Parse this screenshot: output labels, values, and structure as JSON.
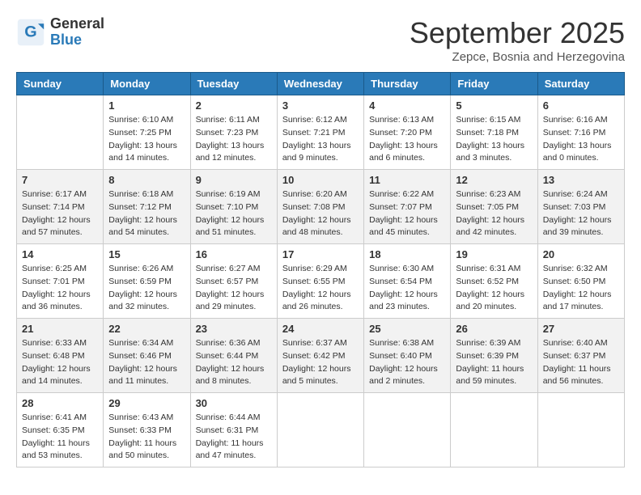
{
  "header": {
    "logo_general": "General",
    "logo_blue": "Blue",
    "month_title": "September 2025",
    "subtitle": "Zepce, Bosnia and Herzegovina"
  },
  "weekdays": [
    "Sunday",
    "Monday",
    "Tuesday",
    "Wednesday",
    "Thursday",
    "Friday",
    "Saturday"
  ],
  "weeks": [
    [
      {
        "day": "",
        "sunrise": "",
        "sunset": "",
        "daylight": ""
      },
      {
        "day": "1",
        "sunrise": "Sunrise: 6:10 AM",
        "sunset": "Sunset: 7:25 PM",
        "daylight": "Daylight: 13 hours and 14 minutes."
      },
      {
        "day": "2",
        "sunrise": "Sunrise: 6:11 AM",
        "sunset": "Sunset: 7:23 PM",
        "daylight": "Daylight: 13 hours and 12 minutes."
      },
      {
        "day": "3",
        "sunrise": "Sunrise: 6:12 AM",
        "sunset": "Sunset: 7:21 PM",
        "daylight": "Daylight: 13 hours and 9 minutes."
      },
      {
        "day": "4",
        "sunrise": "Sunrise: 6:13 AM",
        "sunset": "Sunset: 7:20 PM",
        "daylight": "Daylight: 13 hours and 6 minutes."
      },
      {
        "day": "5",
        "sunrise": "Sunrise: 6:15 AM",
        "sunset": "Sunset: 7:18 PM",
        "daylight": "Daylight: 13 hours and 3 minutes."
      },
      {
        "day": "6",
        "sunrise": "Sunrise: 6:16 AM",
        "sunset": "Sunset: 7:16 PM",
        "daylight": "Daylight: 13 hours and 0 minutes."
      }
    ],
    [
      {
        "day": "7",
        "sunrise": "Sunrise: 6:17 AM",
        "sunset": "Sunset: 7:14 PM",
        "daylight": "Daylight: 12 hours and 57 minutes."
      },
      {
        "day": "8",
        "sunrise": "Sunrise: 6:18 AM",
        "sunset": "Sunset: 7:12 PM",
        "daylight": "Daylight: 12 hours and 54 minutes."
      },
      {
        "day": "9",
        "sunrise": "Sunrise: 6:19 AM",
        "sunset": "Sunset: 7:10 PM",
        "daylight": "Daylight: 12 hours and 51 minutes."
      },
      {
        "day": "10",
        "sunrise": "Sunrise: 6:20 AM",
        "sunset": "Sunset: 7:08 PM",
        "daylight": "Daylight: 12 hours and 48 minutes."
      },
      {
        "day": "11",
        "sunrise": "Sunrise: 6:22 AM",
        "sunset": "Sunset: 7:07 PM",
        "daylight": "Daylight: 12 hours and 45 minutes."
      },
      {
        "day": "12",
        "sunrise": "Sunrise: 6:23 AM",
        "sunset": "Sunset: 7:05 PM",
        "daylight": "Daylight: 12 hours and 42 minutes."
      },
      {
        "day": "13",
        "sunrise": "Sunrise: 6:24 AM",
        "sunset": "Sunset: 7:03 PM",
        "daylight": "Daylight: 12 hours and 39 minutes."
      }
    ],
    [
      {
        "day": "14",
        "sunrise": "Sunrise: 6:25 AM",
        "sunset": "Sunset: 7:01 PM",
        "daylight": "Daylight: 12 hours and 36 minutes."
      },
      {
        "day": "15",
        "sunrise": "Sunrise: 6:26 AM",
        "sunset": "Sunset: 6:59 PM",
        "daylight": "Daylight: 12 hours and 32 minutes."
      },
      {
        "day": "16",
        "sunrise": "Sunrise: 6:27 AM",
        "sunset": "Sunset: 6:57 PM",
        "daylight": "Daylight: 12 hours and 29 minutes."
      },
      {
        "day": "17",
        "sunrise": "Sunrise: 6:29 AM",
        "sunset": "Sunset: 6:55 PM",
        "daylight": "Daylight: 12 hours and 26 minutes."
      },
      {
        "day": "18",
        "sunrise": "Sunrise: 6:30 AM",
        "sunset": "Sunset: 6:54 PM",
        "daylight": "Daylight: 12 hours and 23 minutes."
      },
      {
        "day": "19",
        "sunrise": "Sunrise: 6:31 AM",
        "sunset": "Sunset: 6:52 PM",
        "daylight": "Daylight: 12 hours and 20 minutes."
      },
      {
        "day": "20",
        "sunrise": "Sunrise: 6:32 AM",
        "sunset": "Sunset: 6:50 PM",
        "daylight": "Daylight: 12 hours and 17 minutes."
      }
    ],
    [
      {
        "day": "21",
        "sunrise": "Sunrise: 6:33 AM",
        "sunset": "Sunset: 6:48 PM",
        "daylight": "Daylight: 12 hours and 14 minutes."
      },
      {
        "day": "22",
        "sunrise": "Sunrise: 6:34 AM",
        "sunset": "Sunset: 6:46 PM",
        "daylight": "Daylight: 12 hours and 11 minutes."
      },
      {
        "day": "23",
        "sunrise": "Sunrise: 6:36 AM",
        "sunset": "Sunset: 6:44 PM",
        "daylight": "Daylight: 12 hours and 8 minutes."
      },
      {
        "day": "24",
        "sunrise": "Sunrise: 6:37 AM",
        "sunset": "Sunset: 6:42 PM",
        "daylight": "Daylight: 12 hours and 5 minutes."
      },
      {
        "day": "25",
        "sunrise": "Sunrise: 6:38 AM",
        "sunset": "Sunset: 6:40 PM",
        "daylight": "Daylight: 12 hours and 2 minutes."
      },
      {
        "day": "26",
        "sunrise": "Sunrise: 6:39 AM",
        "sunset": "Sunset: 6:39 PM",
        "daylight": "Daylight: 11 hours and 59 minutes."
      },
      {
        "day": "27",
        "sunrise": "Sunrise: 6:40 AM",
        "sunset": "Sunset: 6:37 PM",
        "daylight": "Daylight: 11 hours and 56 minutes."
      }
    ],
    [
      {
        "day": "28",
        "sunrise": "Sunrise: 6:41 AM",
        "sunset": "Sunset: 6:35 PM",
        "daylight": "Daylight: 11 hours and 53 minutes."
      },
      {
        "day": "29",
        "sunrise": "Sunrise: 6:43 AM",
        "sunset": "Sunset: 6:33 PM",
        "daylight": "Daylight: 11 hours and 50 minutes."
      },
      {
        "day": "30",
        "sunrise": "Sunrise: 6:44 AM",
        "sunset": "Sunset: 6:31 PM",
        "daylight": "Daylight: 11 hours and 47 minutes."
      },
      {
        "day": "",
        "sunrise": "",
        "sunset": "",
        "daylight": ""
      },
      {
        "day": "",
        "sunrise": "",
        "sunset": "",
        "daylight": ""
      },
      {
        "day": "",
        "sunrise": "",
        "sunset": "",
        "daylight": ""
      },
      {
        "day": "",
        "sunrise": "",
        "sunset": "",
        "daylight": ""
      }
    ]
  ]
}
